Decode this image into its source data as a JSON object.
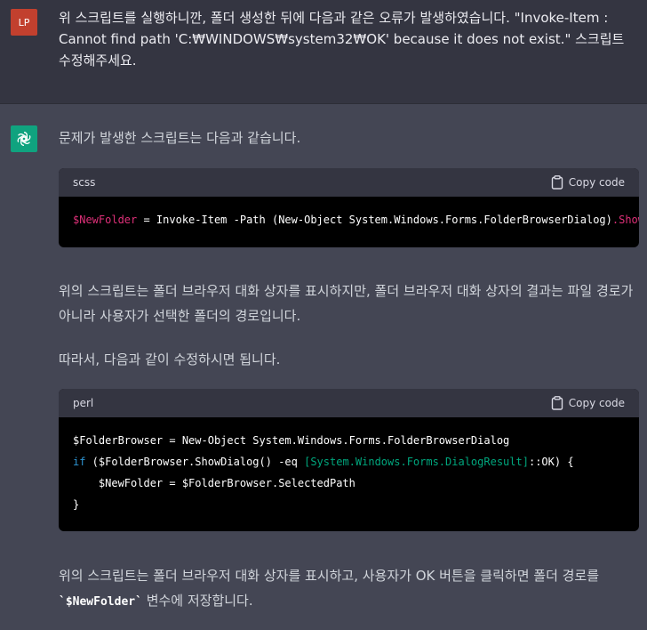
{
  "user": {
    "avatar": "LP",
    "message": "위 스크립트를 실행하니깐, 폴더 생성한 뒤에 다음과 같은 오류가 발생하였습니다. \"Invoke-Item : Cannot find path 'C:₩WINDOWS₩system32₩OK' because it does not exist.\" 스크립트 수정해주세요."
  },
  "assistant": {
    "intro": "문제가 발생한 스크립트는 다음과 같습니다.",
    "code1": {
      "lang": "scss",
      "copy_label": "Copy code",
      "var": "$NewFolder",
      "rest": " = Invoke-Item -Path (New-Object System.Windows.Forms.FolderBrowserDialog)",
      "tail": ".ShowDialog()"
    },
    "para2": "위의 스크립트는 폴더 브라우저 대화 상자를 표시하지만, 폴더 브라우저 대화 상자의 결과는 파일 경로가 아니라 사용자가 선택한 폴더의 경로입니다.",
    "para3": "따라서, 다음과 같이 수정하시면 됩니다.",
    "code2": {
      "lang": "perl",
      "copy_label": "Copy code",
      "line1": "$FolderBrowser = New-Object System.Windows.Forms.FolderBrowserDialog",
      "l2_kw": "if",
      "l2_a": " ($FolderBrowser.ShowDialog() -eq ",
      "l2_type": "[System.Windows.Forms.DialogResult]",
      "l2_b": "::OK) {",
      "line3": "    $NewFolder = $FolderBrowser.SelectedPath",
      "line4": "}"
    },
    "para4_a": "위의 스크립트는 폴더 브라우저 대화 상자를 표시하고, 사용자가 OK 버튼을 클릭하면 폴더 경로를 ",
    "para4_code": "`$NewFolder`",
    "para4_b": " 변수에 저장합니다."
  },
  "colors": {
    "user_bg": "#343541",
    "assistant_bg": "#444654",
    "bot_avatar": "#10a37f",
    "user_avatar": "#c2402e"
  },
  "icons": [
    "clipboard-icon",
    "openai-logo-icon"
  ]
}
